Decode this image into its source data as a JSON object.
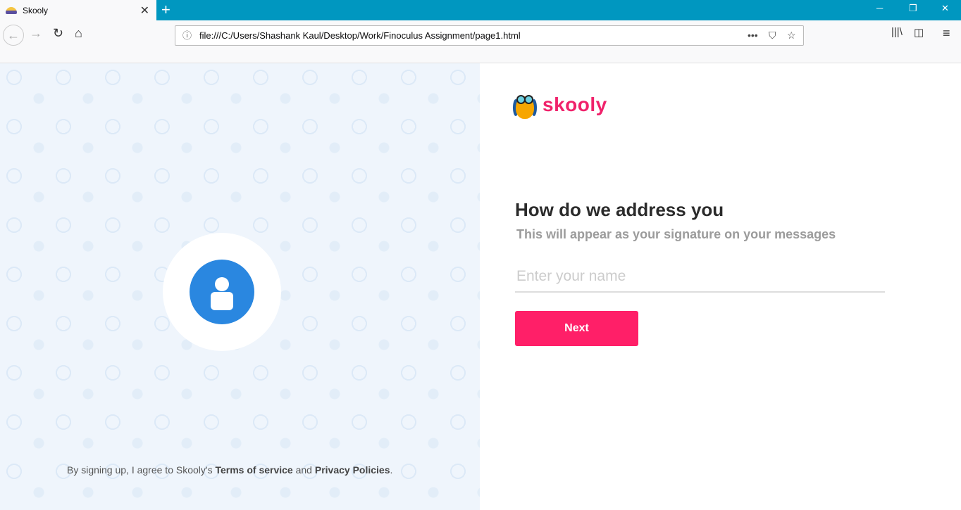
{
  "browser": {
    "tab_title": "Skooly",
    "url": "file:///C:/Users/Shashank Kaul/Desktop/Work/Finoculus Assignment/page1.html"
  },
  "brand": {
    "name": "skooly",
    "accent": "#ff1f68"
  },
  "form": {
    "title": "How do we address you",
    "subtitle": "This will appear as your signature on your messages",
    "name_placeholder": "Enter your name",
    "name_value": "",
    "next_label": "Next"
  },
  "footer": {
    "prefix": "By signing up, I agree to Skooly's ",
    "terms": "Terms of service",
    "and": " and ",
    "privacy": "Privacy Policies",
    "suffix": "."
  }
}
